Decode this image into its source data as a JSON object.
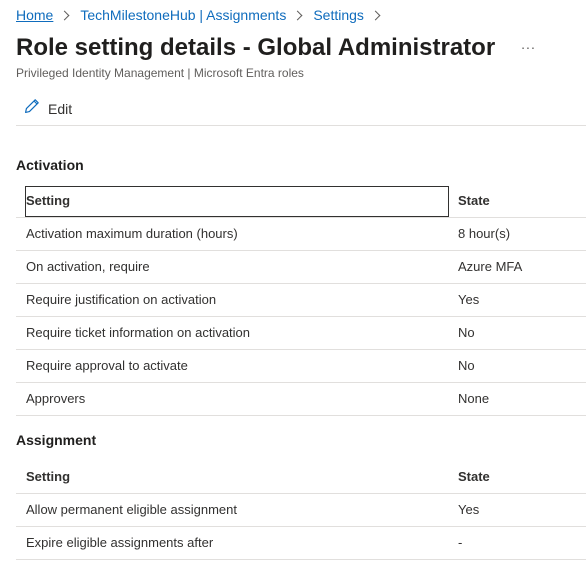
{
  "breadcrumb": {
    "items": [
      "Home",
      "TechMilestoneHub | Assignments",
      "Settings"
    ]
  },
  "header": {
    "title": "Role setting details - Global Administrator",
    "more": "...",
    "subtitle": "Privileged Identity Management | Microsoft Entra roles"
  },
  "toolbar": {
    "edit_label": "Edit"
  },
  "activation": {
    "title": "Activation",
    "columns": [
      "Setting",
      "State"
    ],
    "rows": [
      {
        "setting": "Activation maximum duration (hours)",
        "state": "8 hour(s)"
      },
      {
        "setting": "On activation, require",
        "state": "Azure MFA"
      },
      {
        "setting": "Require justification on activation",
        "state": "Yes"
      },
      {
        "setting": "Require ticket information on activation",
        "state": "No"
      },
      {
        "setting": "Require approval to activate",
        "state": "No"
      },
      {
        "setting": "Approvers",
        "state": "None"
      }
    ]
  },
  "assignment": {
    "title": "Assignment",
    "columns": [
      "Setting",
      "State"
    ],
    "rows": [
      {
        "setting": "Allow permanent eligible assignment",
        "state": "Yes"
      },
      {
        "setting": "Expire eligible assignments after",
        "state": "-"
      }
    ]
  },
  "colors": {
    "link": "#0f6cbd",
    "text": "#323130",
    "divider": "#e1dfdd"
  },
  "icons": {
    "edit": "pencil-icon",
    "more": "more-icon",
    "separator": "chevron-right-icon"
  }
}
